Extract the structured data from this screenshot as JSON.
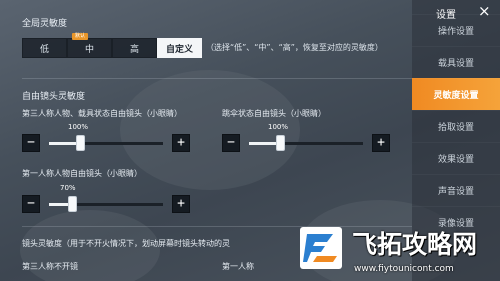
{
  "header": {
    "title": "设置",
    "close_glyph": "×"
  },
  "sidebar": {
    "items": [
      {
        "label": "操作设置"
      },
      {
        "label": "载具设置"
      },
      {
        "label": "灵敏度设置",
        "active": true
      },
      {
        "label": "拾取设置"
      },
      {
        "label": "效果设置"
      },
      {
        "label": "声音设置"
      },
      {
        "label": "录像设置"
      }
    ]
  },
  "global": {
    "title": "全局灵敏度",
    "options": [
      {
        "label": "低",
        "active": false
      },
      {
        "label": "中",
        "active": false,
        "badge": "默认"
      },
      {
        "label": "高",
        "active": false
      },
      {
        "label": "自定义",
        "active": true
      }
    ],
    "hint": "（选择“低”、“中”、“高”，恢复至对应的灵敏度）"
  },
  "free_camera": {
    "title": "自由镜头灵敏度",
    "sliders": [
      {
        "label": "第三人称人物、载具状态自由镜头（小眼睛）",
        "percent": "100%",
        "value": 0.27
      },
      {
        "label": "跳伞状态自由镜头（小眼睛）",
        "percent": "100%",
        "value": 0.27
      },
      {
        "label": "第一人称人物自由镜头（小眼睛）",
        "percent": "70%",
        "value": 0.2
      }
    ],
    "minus_glyph": "−",
    "plus_glyph": "+"
  },
  "lens": {
    "title": "镜头灵敏度",
    "desc": "（用于不开火情况下，划动屏幕时镜头转动的灵",
    "third_person": "第三人称不开镜",
    "first_person_partial": "第一人称"
  },
  "watermark": {
    "title": "飞拓攻略网",
    "url": "www.fiytounicont.com"
  },
  "colors": {
    "accent": "#f08a22",
    "panel_bg": "#46505b"
  }
}
